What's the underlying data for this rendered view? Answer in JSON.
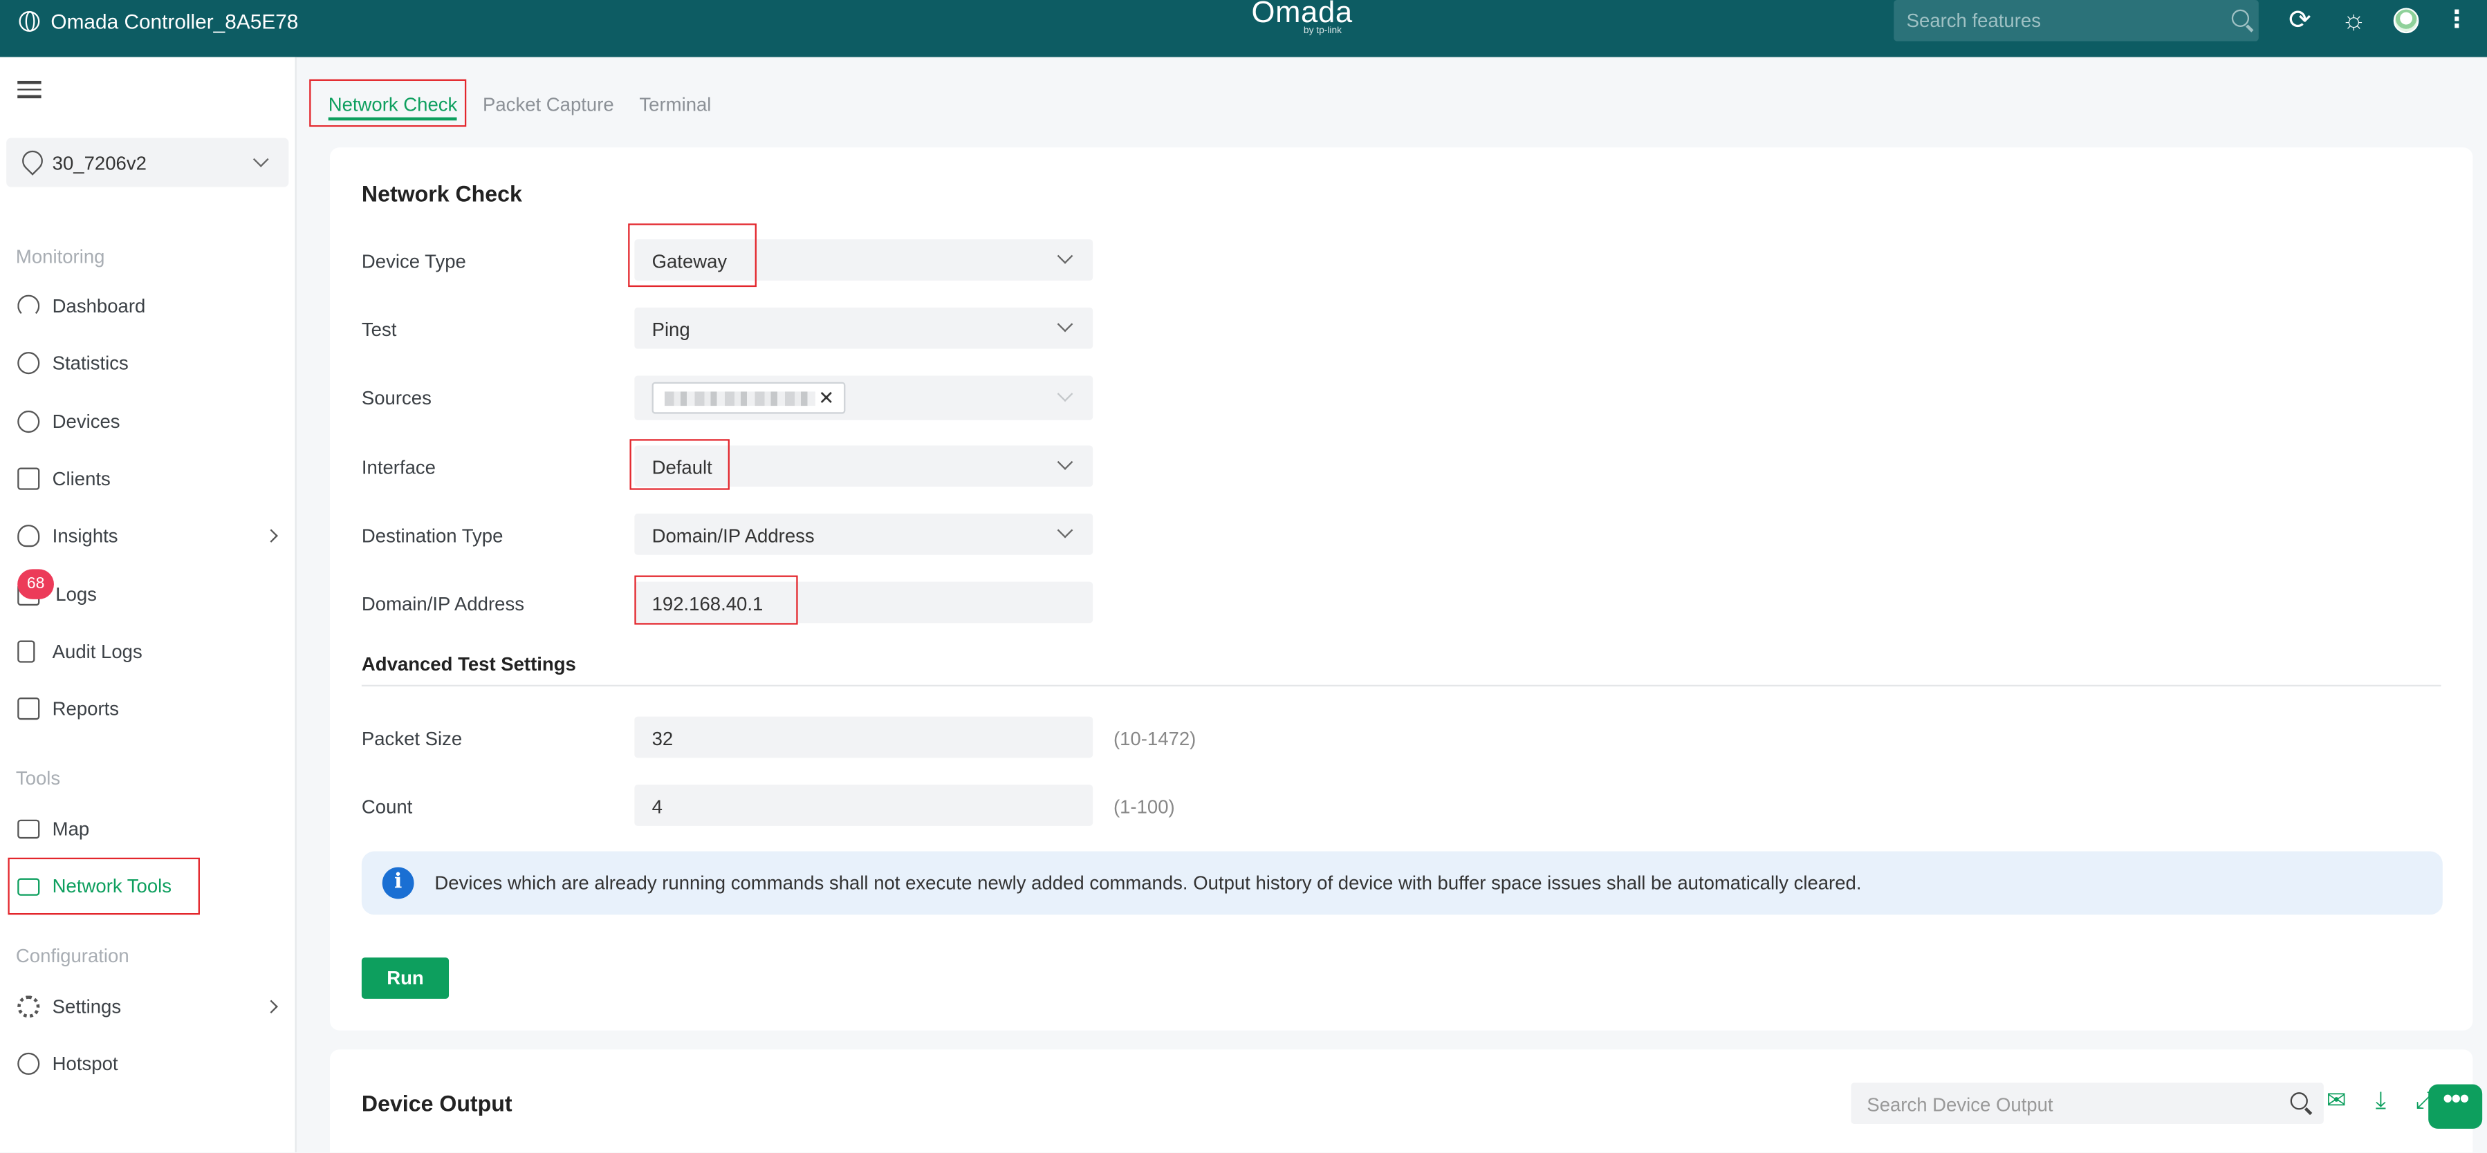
{
  "topbar": {
    "site_title": "Omada Controller_8A5E78",
    "logo_brand": "Omada",
    "logo_sub": "by tp-link",
    "search_placeholder": "Search features"
  },
  "sidebar": {
    "site_name": "30_7206v2",
    "sections": {
      "monitoring": "Monitoring",
      "tools": "Tools",
      "configuration": "Configuration"
    },
    "items": {
      "dashboard": "Dashboard",
      "statistics": "Statistics",
      "devices": "Devices",
      "clients": "Clients",
      "insights": "Insights",
      "logs": "Logs",
      "logs_badge": "68",
      "audit_logs": "Audit Logs",
      "reports": "Reports",
      "map": "Map",
      "network_tools": "Network Tools",
      "settings": "Settings",
      "hotspot": "Hotspot"
    }
  },
  "tabs": [
    "Network Check",
    "Packet Capture",
    "Terminal"
  ],
  "network_check": {
    "title": "Network Check",
    "device_type": {
      "label": "Device Type",
      "value": "Gateway"
    },
    "test": {
      "label": "Test",
      "value": "Ping"
    },
    "sources": {
      "label": "Sources"
    },
    "interface": {
      "label": "Interface",
      "value": "Default"
    },
    "destination_type": {
      "label": "Destination Type",
      "value": "Domain/IP Address"
    },
    "domain_ip": {
      "label": "Domain/IP Address",
      "value": "192.168.40.1"
    },
    "advanced_title": "Advanced Test Settings",
    "packet_size": {
      "label": "Packet Size",
      "value": "32",
      "hint": "(10-1472)"
    },
    "count": {
      "label": "Count",
      "value": "4",
      "hint": "(1-100)"
    },
    "info_text": "Devices which are already running commands shall not execute newly added commands. Output history of device with buffer space issues shall be automatically cleared.",
    "run_label": "Run"
  },
  "device_output": {
    "title": "Device Output",
    "search_placeholder": "Search Device Output"
  },
  "colors": {
    "topbar": "#0d5c63",
    "accent": "#0d9f5e",
    "highlight": "#e3262c",
    "badge": "#ec3b59"
  }
}
